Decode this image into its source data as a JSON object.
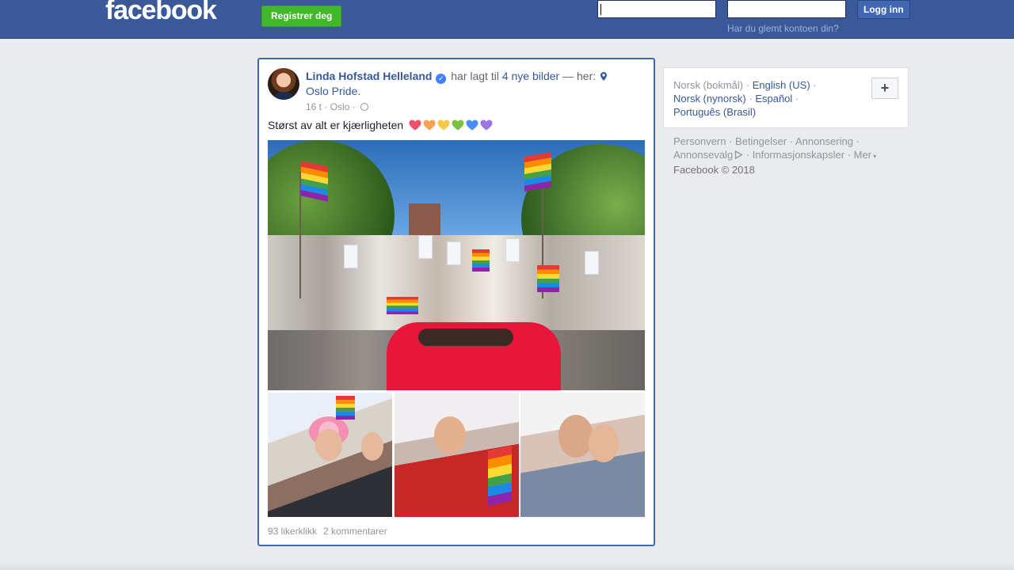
{
  "header": {
    "logo": "facebook",
    "register_label": "Registrer deg",
    "login_label": "Logg inn",
    "forgot_label": "Har du glemt kontoen din?"
  },
  "post": {
    "author": "Linda Hofstad Helleland",
    "action_text": "har lagt til",
    "photos_link": "4 nye bilder",
    "here_text": "— her:",
    "place": "Oslo Pride.",
    "time": "16 t",
    "city": "Oslo",
    "text": "Størst av alt er kjærligheten",
    "hearts": [
      "#f0506e",
      "#f5a35b",
      "#f7c948",
      "#7cc143",
      "#4c8cf5",
      "#9b74e8"
    ],
    "likes": "93 likerklikk",
    "comments": "2 kommentarer"
  },
  "languages": {
    "current": "Norsk (bokmål)",
    "options": [
      "English (US)",
      "Norsk (nynorsk)",
      "Español",
      "Português (Brasil)"
    ]
  },
  "footer": {
    "links": [
      "Personvern",
      "Betingelser",
      "Annonsering",
      "Annonsevalg",
      "Informasjonskapsler",
      "Mer"
    ],
    "copyright": "Facebook © 2018"
  },
  "colors": {
    "brand": "#3b5998",
    "link": "#365899",
    "register": "#42b72a",
    "focus_border": "#4267b2"
  },
  "icons": {
    "verified": "verified-badge-icon",
    "location": "location-pin-icon",
    "privacy": "globe-icon",
    "add": "plus-icon",
    "adchoices": "adchoices-icon",
    "more": "caret-down-icon"
  }
}
